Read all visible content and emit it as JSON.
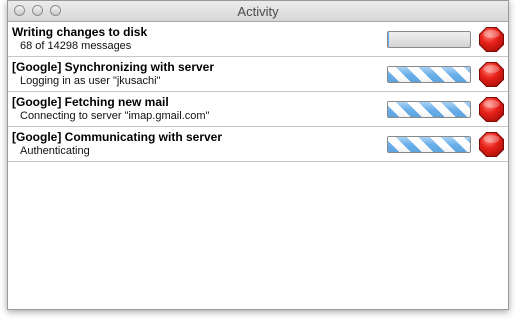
{
  "window": {
    "title": "Activity"
  },
  "icons": {
    "stop": "stop-octagon-icon",
    "traffic_lights": [
      "close-icon",
      "minimize-icon",
      "zoom-icon"
    ]
  },
  "colors": {
    "stop_red": "#e8221a",
    "progress_stripe": "#66aeea"
  },
  "tasks": [
    {
      "title": "Writing changes to disk",
      "status": "68 of 14298 messages",
      "progress_fraction": 0.005,
      "indeterminate": false
    },
    {
      "title": "[Google] Synchronizing with server",
      "status": "Logging in as user \"jkusachi\"",
      "indeterminate": true
    },
    {
      "title": "[Google] Fetching new mail",
      "status": "Connecting to server \"imap.gmail.com\"",
      "indeterminate": true
    },
    {
      "title": "[Google] Communicating with server",
      "status": "Authenticating",
      "indeterminate": true
    }
  ]
}
